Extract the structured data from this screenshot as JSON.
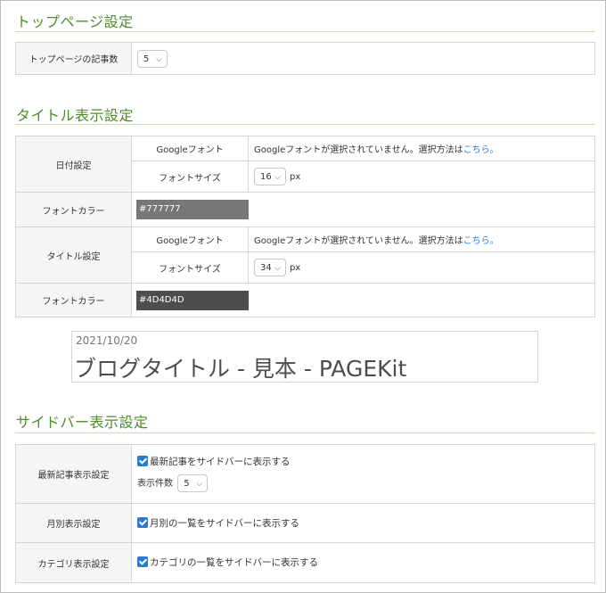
{
  "top_section": {
    "title": "トップページ設定",
    "articles_label": "トップページの記事数",
    "articles_value": "5"
  },
  "title_section": {
    "title": "タイトル表示設定",
    "date_settings": {
      "label": "日付設定",
      "google_font_label": "Googleフォント",
      "google_font_text": "Googleフォントが選択されていません。選択方法は",
      "google_font_link": "こちら。",
      "font_size_label": "フォントサイズ",
      "font_size_value": "16",
      "font_size_unit": "px",
      "font_color_label": "フォントカラー",
      "font_color_value": "#777777"
    },
    "title_settings": {
      "label": "タイトル設定",
      "google_font_label": "Googleフォント",
      "google_font_text": "Googleフォントが選択されていません。選択方法は",
      "google_font_link": "こちら。",
      "font_size_label": "フォントサイズ",
      "font_size_value": "34",
      "font_size_unit": "px",
      "font_color_label": "フォントカラー",
      "font_color_value": "#4D4D4D"
    },
    "preview": {
      "date": "2021/10/20",
      "title": "ブログタイトル - 見本 - PAGEKit"
    }
  },
  "sidebar_section": {
    "title": "サイドバー表示設定",
    "recent": {
      "label": "最新記事表示設定",
      "checkbox_label": "最新記事をサイドバーに表示する",
      "count_label": "表示件数",
      "count_value": "5"
    },
    "monthly": {
      "label": "月別表示設定",
      "checkbox_label": "月別の一覧をサイドバーに表示する"
    },
    "category": {
      "label": "カテゴリ表示設定",
      "checkbox_label": "カテゴリの一覧をサイドバーに表示する"
    }
  },
  "colors": {
    "accent_green": "#4d8c2a",
    "link_blue": "#2d7bd1",
    "date_swatch": "#777777",
    "title_swatch": "#4d4d4d"
  }
}
